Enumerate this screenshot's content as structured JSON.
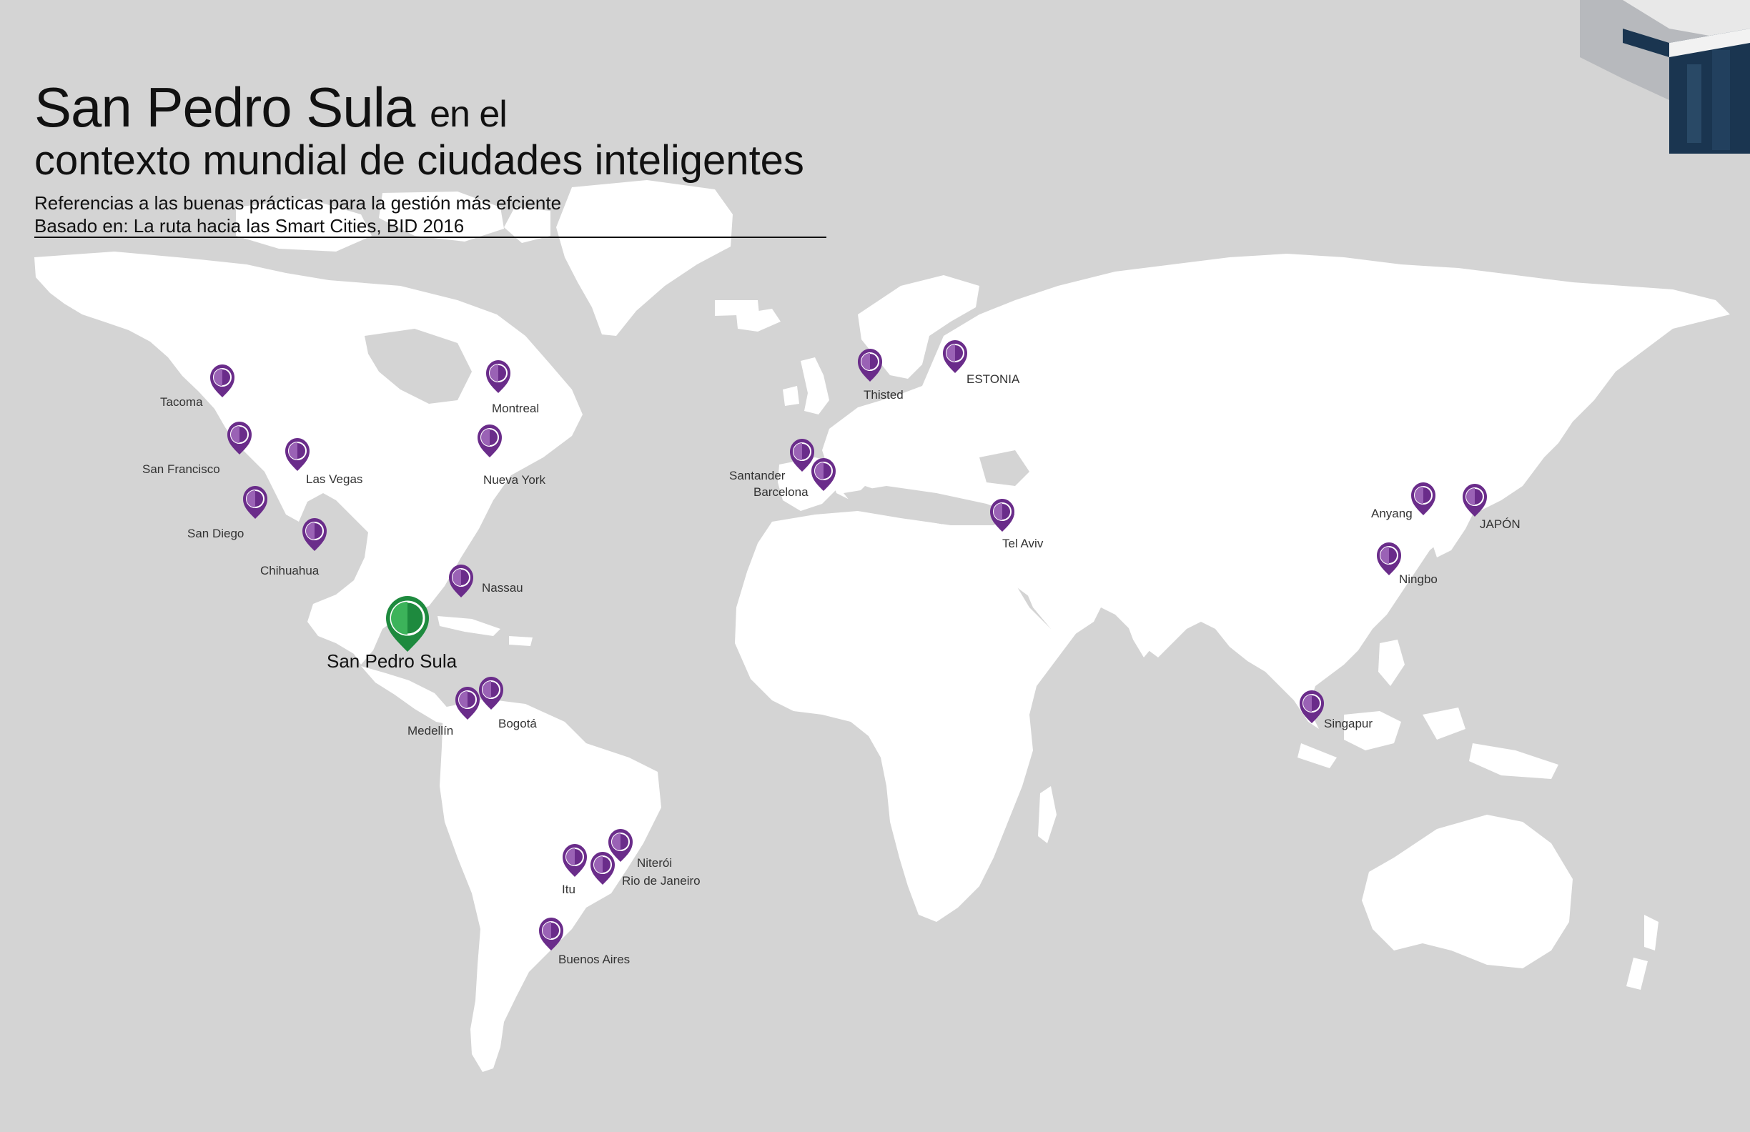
{
  "title": {
    "main": "San Pedro Sula",
    "connector": "en el",
    "line2": "contexto mundial de ciudades inteligentes"
  },
  "subtitle": {
    "line1": "Referencias a las buenas prácticas para la gestión más efciente",
    "line2": "Basado en: La ruta hacia las Smart Cities, BID 2016"
  },
  "colors": {
    "background": "#d4d4d4",
    "land": "#ffffff",
    "pin": "#6a2c8a",
    "pin_light": "#9a62b5",
    "highlight": "#1e8a3e",
    "highlight_light": "#3cb35a",
    "corner_dark": "#1a3550"
  },
  "highlight_city": {
    "name": "San Pedro Sula",
    "icon": "map-pin-icon"
  },
  "cities": [
    {
      "name": "Tacoma"
    },
    {
      "name": "San Francisco"
    },
    {
      "name": "Las Vegas"
    },
    {
      "name": "San Diego"
    },
    {
      "name": "Chihuahua"
    },
    {
      "name": "Montreal"
    },
    {
      "name": "Nueva York"
    },
    {
      "name": "Nassau"
    },
    {
      "name": "Medellín"
    },
    {
      "name": "Bogotá"
    },
    {
      "name": "Itu"
    },
    {
      "name": "Niterói"
    },
    {
      "name": "Rio de Janeiro"
    },
    {
      "name": "Buenos Aires"
    },
    {
      "name": "Thisted"
    },
    {
      "name": "ESTONIA"
    },
    {
      "name": "Santander"
    },
    {
      "name": "Barcelona"
    },
    {
      "name": "Tel Aviv"
    },
    {
      "name": "Anyang"
    },
    {
      "name": "JAPÓN"
    },
    {
      "name": "Ningbo"
    },
    {
      "name": "Singapur"
    }
  ]
}
